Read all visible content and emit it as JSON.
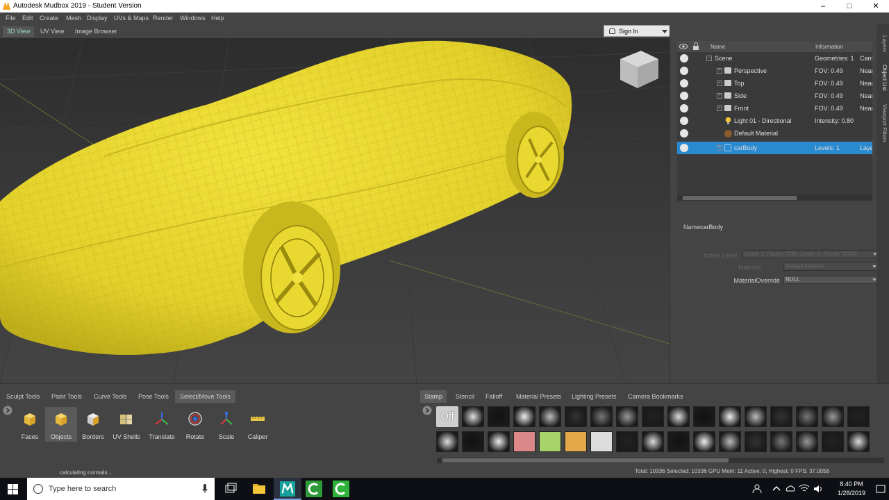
{
  "window": {
    "title": "Autodesk Mudbox 2019 - Student Version",
    "minimize": "–",
    "maximize": "□",
    "close": "✕"
  },
  "menu": [
    "File",
    "Edit",
    "Create",
    "Mesh",
    "Display",
    "UVs & Maps",
    "Render",
    "Windows",
    "Help"
  ],
  "view_tabs": [
    "3D View",
    "UV View",
    "Image Browser"
  ],
  "signin": {
    "label": "Sign In"
  },
  "side_tabs": [
    "Layers",
    "Object List",
    "Viewport Filters"
  ],
  "tree": {
    "headers": {
      "name": "Name",
      "info": "Information"
    },
    "rows": [
      {
        "name": "Scene",
        "info": "Geometries: 1",
        "info2": "Cam",
        "icon": "expand-icon"
      },
      {
        "name": "Perspective",
        "info": "FOV: 0.49",
        "info2": "Near",
        "icon": "camera-icon"
      },
      {
        "name": "Top",
        "info": "FOV: 0.49",
        "info2": "Near",
        "icon": "camera-icon"
      },
      {
        "name": "Side",
        "info": "FOV: 0.49",
        "info2": "Near",
        "icon": "camera-icon"
      },
      {
        "name": "Front",
        "info": "FOV: 0.49",
        "info2": "Near",
        "icon": "camera-icon"
      },
      {
        "name": "Light 01 - Directional",
        "info": "Intensity: 0.80",
        "info2": "",
        "icon": "light-bulb-icon"
      },
      {
        "name": "Default Material",
        "info": "",
        "info2": "",
        "icon": "material-sphere-icon"
      },
      {
        "name": "carBody",
        "info": "Levels: 1",
        "info2": "Laye",
        "icon": "mesh-icon",
        "selected": true
      }
    ]
  },
  "properties": {
    "name_label": "Name",
    "name_value": "carBody",
    "active_level_label": "Active Level",
    "active_level_value": "Level: 1, Faces: 2080, Level: 0, Faces: 10336",
    "material_label": "Material",
    "material_value": "Default Material",
    "override_label": "MaterialOverride",
    "override_value": "NULL"
  },
  "tool_tabs": [
    "Sculpt Tools",
    "Paint Tools",
    "Curve Tools",
    "Pose Tools",
    "Select/Move Tools"
  ],
  "tools": [
    "Faces",
    "Objects",
    "Borders",
    "UV Shells",
    "Translate",
    "Rotate",
    "Scale",
    "Caliper"
  ],
  "stamp_tabs": [
    "Stamp",
    "Stencil",
    "Falloff",
    "Material Presets",
    "Lighting Presets",
    "Camera Bookmarks"
  ],
  "stamp_off": "Off",
  "status": {
    "left": "calculating normals...",
    "right": "Total: 10336  Selected: 10336 GPU Mem: 11  Active: 0, Highest: 0  FPS: 37.0058"
  },
  "taskbar": {
    "search_placeholder": "Type here to search",
    "time": "8:40 PM",
    "date": "1/28/2019"
  },
  "colors": {
    "accent": "#2a8ad0",
    "model": "#e6d632",
    "bg": "#444444"
  }
}
